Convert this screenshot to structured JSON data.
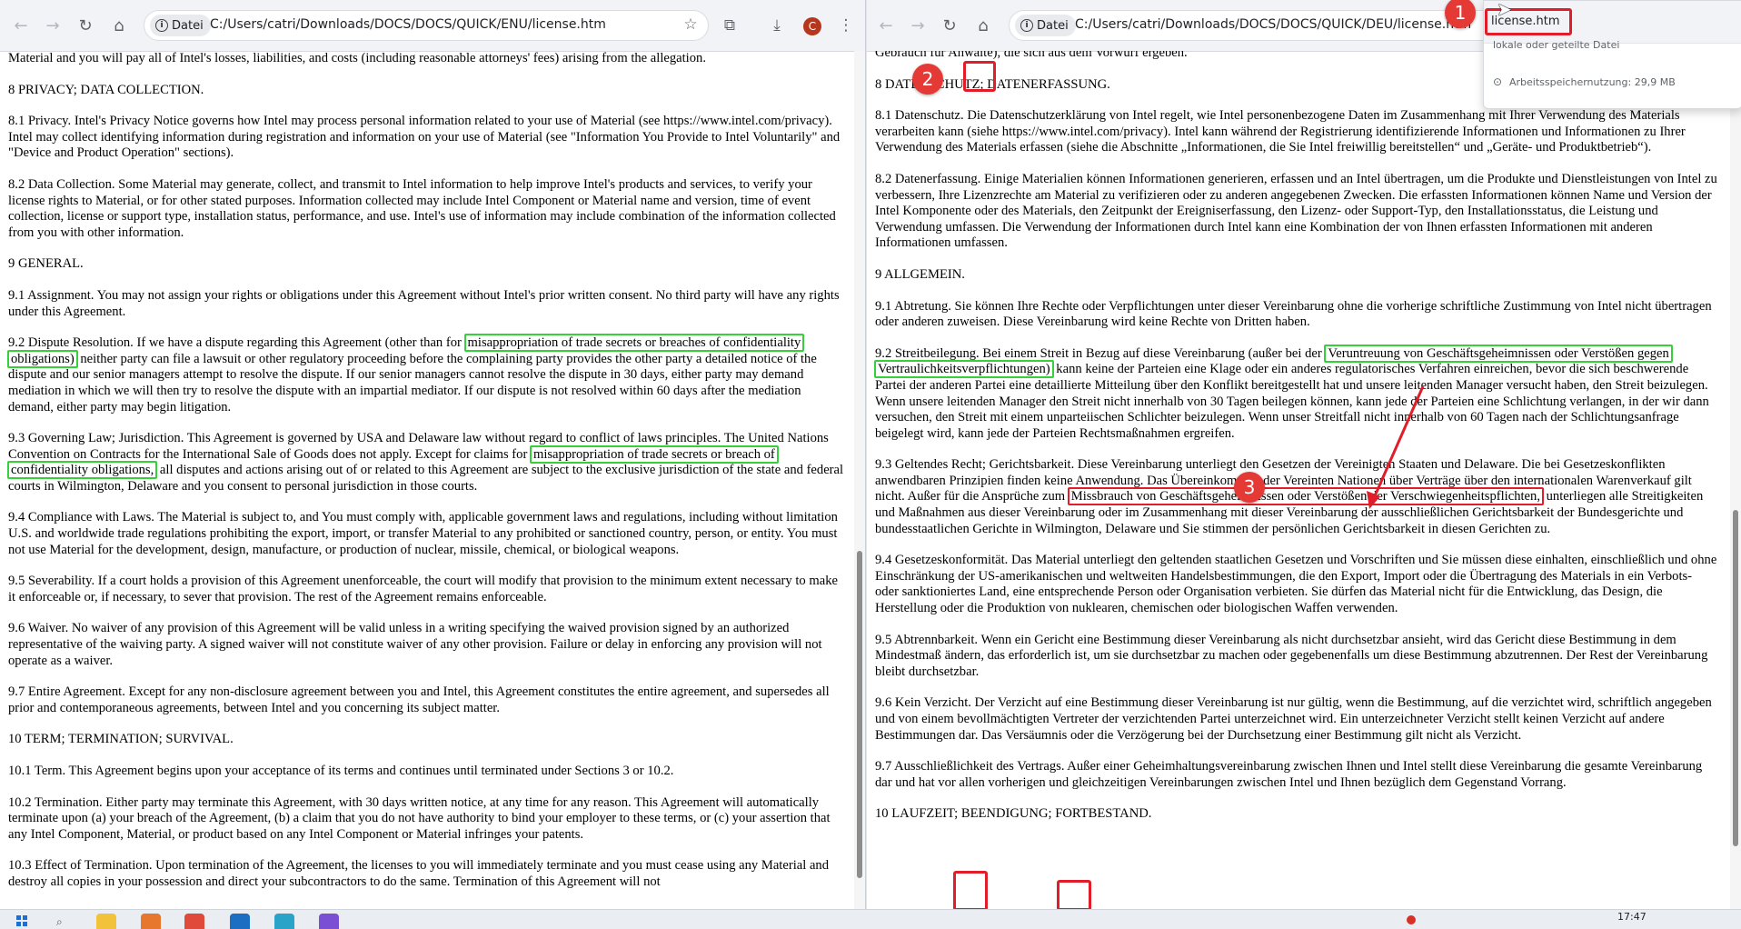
{
  "browser_left": {
    "chip_label": "Datei",
    "url": "C:/Users/catri/Downloads/DOCS/DOCS/QUICK/ENU/license.htm",
    "avatar_letter": "C"
  },
  "browser_right": {
    "chip_label": "Datei",
    "url": "C:/Users/catri/Downloads/DOCS/DOCS/QUICK/DEU/license.htm"
  },
  "popup": {
    "title": "license.htm",
    "subtitle": "lokale oder geteilte Datei",
    "memory": "Arbeitsspeichernutzung: 29,9 MB"
  },
  "left_doc": {
    "p0": "Material and you will pay all of Intel's losses, liabilities, and costs (including reasonable attorneys' fees) arising from the allegation.",
    "p1": "8 PRIVACY; DATA COLLECTION.",
    "p2": "8.1 Privacy. Intel's Privacy Notice governs how Intel may process personal information related to your use of Material (see https://www.intel.com/privacy). Intel may collect identifying information during registration and information on your use of Material (see \"Information You Provide to Intel Voluntarily\" and \"Device and Product Operation\" sections).",
    "p3": "8.2 Data Collection. Some Material may generate, collect, and transmit to Intel information to help improve Intel's products and services, to verify your license rights to Material, or for other stated purposes. Information collected may include Intel Component or Material name and version, time of event collection, license or support type, installation status, performance, and use. Intel's use of information may include combination of the information collected from you with other information.",
    "p4": "9 GENERAL.",
    "p5": "9.1 Assignment. You may not assign your rights or obligations under this Agreement without Intel's prior written consent. No third party will have any rights under this Agreement.",
    "p6_a": "9.2 Dispute Resolution. If we have a dispute regarding this Agreement (other than for ",
    "p6_hl": "misappropriation of trade secrets or breaches of confidentiality obligations)",
    "p6_b": " neither party can file a lawsuit or other regulatory proceeding before the complaining party provides the other party a detailed notice of the dispute and our senior managers attempt to resolve the dispute. If our senior managers cannot resolve the dispute in 30 days, either party may demand mediation in which we will then try to resolve the dispute with an impartial mediator. If our dispute is not resolved within 60 days after the mediation demand, either party may begin litigation.",
    "p7_a": "9.3 Governing Law; Jurisdiction. This Agreement is governed by USA and Delaware law without regard to conflict of laws principles. The United Nations Convention on Contracts for the International Sale of Goods does not apply. Except for claims for ",
    "p7_hl": "misappropriation of trade secrets or breach of confidentiality obligations,",
    "p7_b": " all disputes and actions arising out of or related to this Agreement are subject to the exclusive jurisdiction of the state and federal courts in Wilmington, Delaware and you consent to personal jurisdiction in those courts.",
    "p8": "9.4 Compliance with Laws. The Material is subject to, and You must comply with, applicable government laws and regulations, including without limitation U.S. and worldwide trade regulations prohibiting the export, import, or transfer Material to any prohibited or sanctioned country, person, or entity. You must not use Material for the development, design, manufacture, or production of nuclear, missile, chemical, or biological weapons.",
    "p9": "9.5 Severability. If a court holds a provision of this Agreement unenforceable, the court will modify that provision to the minimum extent necessary to make it enforceable or, if necessary, to sever that provision. The rest of the Agreement remains enforceable.",
    "p10": "9.6 Waiver. No waiver of any provision of this Agreement will be valid unless in a writing specifying the waived provision signed by an authorized representative of the waiving party. A signed waiver will not constitute waiver of any other provision. Failure or delay in enforcing any provision will not operate as a waiver.",
    "p11": "9.7 Entire Agreement. Except for any non-disclosure agreement between you and Intel, this Agreement constitutes the entire agreement, and supersedes all prior and contemporaneous agreements, between Intel and you concerning its subject matter.",
    "p12": "10 TERM; TERMINATION; SURVIVAL.",
    "p13": "10.1 Term. This Agreement begins upon your acceptance of its terms and continues until terminated under Sections 3 or 10.2.",
    "p14": "10.2 Termination. Either party may terminate this Agreement, with 30 days written notice, at any time for any reason. This Agreement will automatically terminate upon (a) your breach of the Agreement, (b) a claim that you do not have authority to bind your employer to these terms, or (c) your assertion that any Intel Component, Material, or product based on any Intel Component or Material infringes your patents.",
    "p15": "10.3 Effect of Termination. Upon termination of the Agreement, the licenses to you will immediately terminate and you must cease using any Material and destroy all copies in your possession and direct your subcontractors to do the same. Termination of this Agreement will not"
  },
  "right_doc": {
    "p0": "Gebrauch für Anwälte), die sich aus dem Vorwurf ergeben.",
    "p1": "8 DATENSCHUTZ; DATENERFASSUNG.",
    "p2": "8.1 Datenschutz. Die Datenschutzerklärung von Intel regelt, wie Intel personenbezogene Daten im Zusammenhang mit Ihrer Verwendung des Materials verarbeiten kann (siehe https://www.intel.com/privacy). Intel kann während der Registrierung identifizierende Informationen und Informationen zu Ihrer Verwendung des Materials erfassen (siehe die Abschnitte „Informationen, die Sie Intel freiwillig bereitstellen“ und „Geräte- und Produktbetrieb“).",
    "p3": "8.2 Datenerfassung. Einige Materialien können Informationen generieren, erfassen und an Intel übertragen, um die Produkte und Dienstleistungen von Intel zu verbessern, Ihre Lizenzrechte am Material zu verifizieren oder zu anderen angegebenen Zwecken. Die erfassten Informationen können Name und Version der Intel Komponente oder des Materials, den Zeitpunkt der Ereigniserfassung, den Lizenz- oder Support-Typ, den Installationsstatus, die Leistung und Verwendung umfassen. Die Verwendung der Informationen durch Intel kann eine Kombination der von Ihnen erfassten Informationen mit anderen Informationen umfassen.",
    "p4": "9 ALLGEMEIN.",
    "p5": "9.1 Abtretung. Sie können Ihre Rechte oder Verpflichtungen unter dieser Vereinbarung ohne die vorherige schriftliche Zustimmung von Intel nicht übertragen oder anderen zuweisen. Diese Vereinbarung wird keine Rechte von Dritten haben.",
    "p6_a": "9.2 Streitbeilegung. Bei einem Streit in Bezug auf diese Vereinbarung (außer bei der ",
    "p6_hl": "Veruntreuung von Geschäftsgeheimnissen oder Verstößen gegen Vertraulichkeitsverpflichtungen)",
    "p6_b": " kann keine der Parteien eine Klage oder ein anderes regulatorisches Verfahren einreichen, bevor die sich beschwerende Partei der anderen Partei eine detaillierte Mitteilung über den Konflikt bereitgestellt hat und unsere leitenden Manager versucht haben, den Streit beizulegen. Wenn unsere leitenden Manager den Streit nicht innerhalb von 30 Tagen beilegen können, kann jede der Parteien eine Schlichtung verlangen, in der wir dann versuchen, den Streit mit einem unparteiischen Schlichter beizulegen. Wenn unser Streitfall nicht innerhalb von 60 Tagen nach der Schlichtungsanfrage beigelegt wird, kann jede der Parteien Rechtsmaßnahmen ergreifen.",
    "p7_a": "9.3 Geltendes Recht; Gerichtsbarkeit. Diese Vereinbarung unterliegt den Gesetzen der Vereinigten Staaten und Delaware. Die bei Gesetzeskonflikten anwendbaren Prinzipien finden keine Anwendung. Das Übereinkommen der Vereinten Nationen über Verträge über den internationalen Warenverkauf gilt nicht. Außer für die Ansprüche zum ",
    "p7_hl": "Missbrauch von Geschäftsgeheimnissen oder Verstößen der Verschwiegenheitspflichten,",
    "p7_b": " unterliegen alle Streitigkeiten und Maßnahmen aus dieser Vereinbarung oder im Zusammenhang mit dieser Vereinbarung der ausschließlichen Gerichtsbarkeit der Bundesgerichte und bundesstaatlichen Gerichte in Wilmington, Delaware und Sie stimmen der persönlichen Gerichtsbarkeit in diesen Gerichten zu.",
    "p8": "9.4 Gesetzeskonformität. Das Material unterliegt den geltenden staatlichen Gesetzen und Vorschriften und Sie müssen diese einhalten, einschließlich und ohne Einschränkung der US-amerikanischen und weltweiten Handelsbestimmungen, die den Export, Import oder die Übertragung des Materials in ein Verbots- oder sanktioniertes Land, eine entsprechende Person oder Organisation verbieten. Sie dürfen das Material nicht für die Entwicklung, das Design, die Herstellung oder die Produktion von nuklearen, chemischen oder biologischen Waffen verwenden.",
    "p9": "9.5 Abtrennbarkeit. Wenn ein Gericht eine Bestimmung dieser Vereinbarung als nicht durchsetzbar ansieht, wird das Gericht diese Bestimmung in dem Mindestmaß ändern, das erforderlich ist, um sie durchsetzbar zu machen oder gegebenenfalls um diese Bestimmung abzutrennen. Der Rest der Vereinbarung bleibt durchsetzbar.",
    "p10": "9.6 Kein Verzicht. Der Verzicht auf eine Bestimmung dieser Vereinbarung ist nur gültig, wenn die Bestimmung, auf die verzichtet wird, schriftlich angegeben und von einem bevollmächtigten Vertreter der verzichtenden Partei unterzeichnet wird. Ein unterzeichneter Verzicht stellt keinen Verzicht auf andere Bestimmungen dar. Das Versäumnis oder die Verzögerung bei der Durchsetzung einer Bestimmung gilt nicht als Verzicht.",
    "p11": "9.7 Ausschließlichkeit des Vertrags. Außer einer Geheimhaltungsvereinbarung zwischen Ihnen und Intel stellt diese Vereinbarung die gesamte Vereinbarung dar und hat vor allen vorherigen und gleichzeitigen Vereinbarungen zwischen Intel und Ihnen bezüglich dem Gegenstand Vorrang.",
    "p12": "10 LAUFZEIT; BEENDIGUNG; FORTBESTAND."
  },
  "annotations": {
    "badge1": "1",
    "badge2": "2",
    "badge3": "3"
  },
  "taskbar": {
    "time": "17:47"
  },
  "colors": {
    "green_highlight": "#36d13a",
    "red_highlight": "#e11d2a",
    "badge": "#e53935"
  }
}
